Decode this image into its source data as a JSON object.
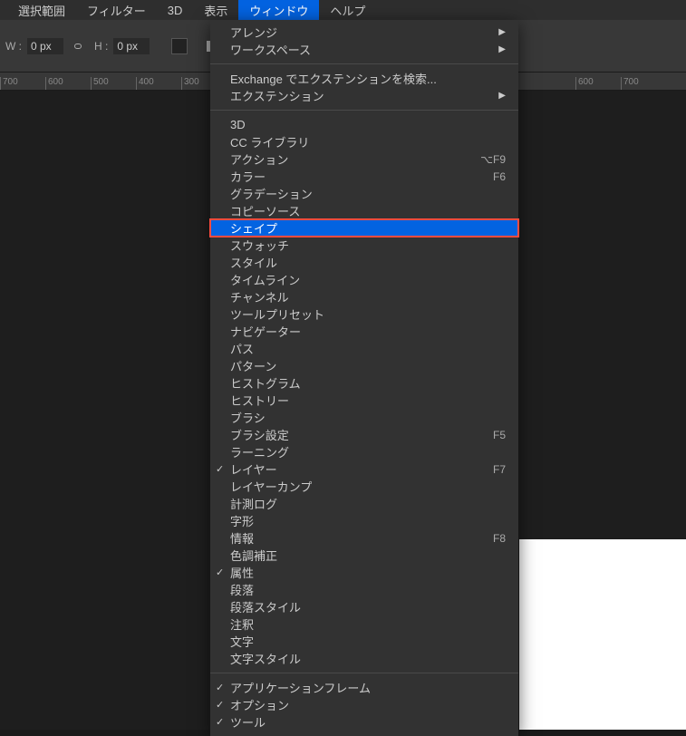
{
  "menubar": {
    "items": [
      "選択範囲",
      "フィルター",
      "3D",
      "表示",
      "ウィンドウ",
      "ヘルプ"
    ],
    "activeIndex": 4
  },
  "toolbar": {
    "w_label": "W :",
    "w_value": "0 px",
    "h_label": "H :",
    "h_value": "0 px"
  },
  "ruler": {
    "left": [
      "700",
      "600",
      "500",
      "400",
      "300"
    ],
    "right": [
      "600",
      "700"
    ]
  },
  "dropdown": {
    "groups": [
      {
        "items": [
          {
            "label": "アレンジ",
            "submenu": true
          },
          {
            "label": "ワークスペース",
            "submenu": true
          }
        ]
      },
      {
        "items": [
          {
            "label": "Exchange でエクステンションを検索..."
          },
          {
            "label": "エクステンション",
            "submenu": true
          }
        ]
      },
      {
        "items": [
          {
            "label": "3D"
          },
          {
            "label": "CC ライブラリ"
          },
          {
            "label": "アクション",
            "shortcut": "⌥F9"
          },
          {
            "label": "カラー",
            "shortcut": "F6"
          },
          {
            "label": "グラデーション"
          },
          {
            "label": "コピーソース"
          },
          {
            "label": "シェイプ",
            "highlight": true
          },
          {
            "label": "スウォッチ"
          },
          {
            "label": "スタイル"
          },
          {
            "label": "タイムライン"
          },
          {
            "label": "チャンネル"
          },
          {
            "label": "ツールプリセット"
          },
          {
            "label": "ナビゲーター"
          },
          {
            "label": "パス"
          },
          {
            "label": "パターン"
          },
          {
            "label": "ヒストグラム"
          },
          {
            "label": "ヒストリー"
          },
          {
            "label": "ブラシ"
          },
          {
            "label": "ブラシ設定",
            "shortcut": "F5"
          },
          {
            "label": "ラーニング"
          },
          {
            "label": "レイヤー",
            "shortcut": "F7",
            "checked": true
          },
          {
            "label": "レイヤーカンプ"
          },
          {
            "label": "計測ログ"
          },
          {
            "label": "字形"
          },
          {
            "label": "情報",
            "shortcut": "F8"
          },
          {
            "label": "色調補正"
          },
          {
            "label": "属性",
            "checked": true
          },
          {
            "label": "段落"
          },
          {
            "label": "段落スタイル"
          },
          {
            "label": "注釈"
          },
          {
            "label": "文字"
          },
          {
            "label": "文字スタイル"
          }
        ]
      },
      {
        "items": [
          {
            "label": "アプリケーションフレーム",
            "checked": true
          },
          {
            "label": "オプション",
            "checked": true
          },
          {
            "label": "ツール",
            "checked": true
          }
        ]
      }
    ]
  }
}
